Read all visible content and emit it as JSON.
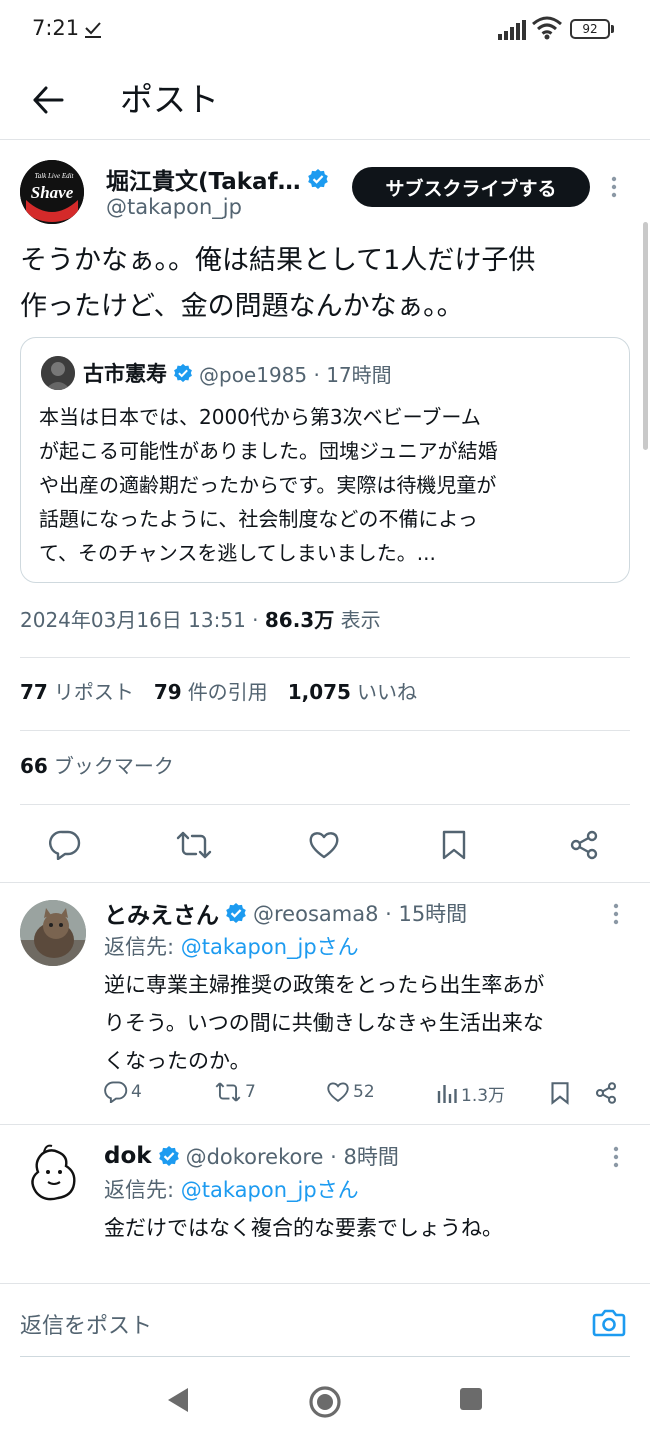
{
  "status_bar": {
    "time": "7:21",
    "battery": "92"
  },
  "header": {
    "title": "ポスト"
  },
  "main_post": {
    "author_name": "堀江貴文(Takaf…",
    "handle": "@takapon_jp",
    "subscribe_label": "サブスクライブする",
    "text_line1": "そうかなぁ。。俺は結果として1人だけ子供",
    "text_line2": "作ったけど、金の問題なんかなぁ。。",
    "avatar_text": "Shave",
    "avatar_small_text": "Talk Live Edit"
  },
  "quoted_post": {
    "author_name": "古市憲寿",
    "meta": "@poe1985 · 17時間",
    "lines": [
      "本当は日本では、2000代から第3次ベビーブーム",
      "が起こる可能性がありました。団塊ジュニアが結婚",
      "や出産の適齢期だったからです。実際は待機児童が",
      "話題になったように、社会制度などの不備によっ",
      "て、そのチャンスを逃してしまいました。..."
    ]
  },
  "post_meta": {
    "datetime": "2024年03月16日 13:51 · ",
    "views": "86.3万",
    "views_label": " 表示"
  },
  "stats": {
    "reposts": "77",
    "reposts_label": "リポスト",
    "quotes": "79",
    "quotes_label": "件の引用",
    "likes": "1,075",
    "likes_label": "いいね",
    "bookmarks": "66",
    "bookmarks_label": "ブックマーク"
  },
  "replies": [
    {
      "name": "とみえさん",
      "meta": "@reosama8 · 15時間",
      "reply_to_prefix": "返信先: ",
      "reply_to_handle": "@takapon_jpさん",
      "lines": [
        "逆に専業主婦推奨の政策をとったら出生率あが",
        "りそう。いつの間に共働きしなきゃ生活出来な",
        "くなったのか。"
      ],
      "replies": "4",
      "reposts": "7",
      "likes": "52",
      "views": "1.3万"
    },
    {
      "name": "dok",
      "meta": "@dokorekore · 8時間",
      "reply_to_prefix": "返信先: ",
      "reply_to_handle": "@takapon_jpさん",
      "lines": [
        "金だけではなく複合的な要素でしょうね。"
      ]
    }
  ],
  "composer": {
    "placeholder": "返信をポスト"
  },
  "colors": {
    "accent": "#1d9bf0",
    "text": "#0f1419",
    "secondary": "#536471",
    "border": "#e1e4e7",
    "brand_red": "#d42a2a"
  },
  "icons": [
    "back-arrow-icon",
    "verified-badge-icon",
    "more-icon",
    "reply-icon",
    "repost-icon",
    "like-icon",
    "bookmark-icon",
    "share-icon",
    "views-icon",
    "camera-icon",
    "nav-back-icon",
    "nav-home-icon",
    "nav-recents-icon"
  ]
}
